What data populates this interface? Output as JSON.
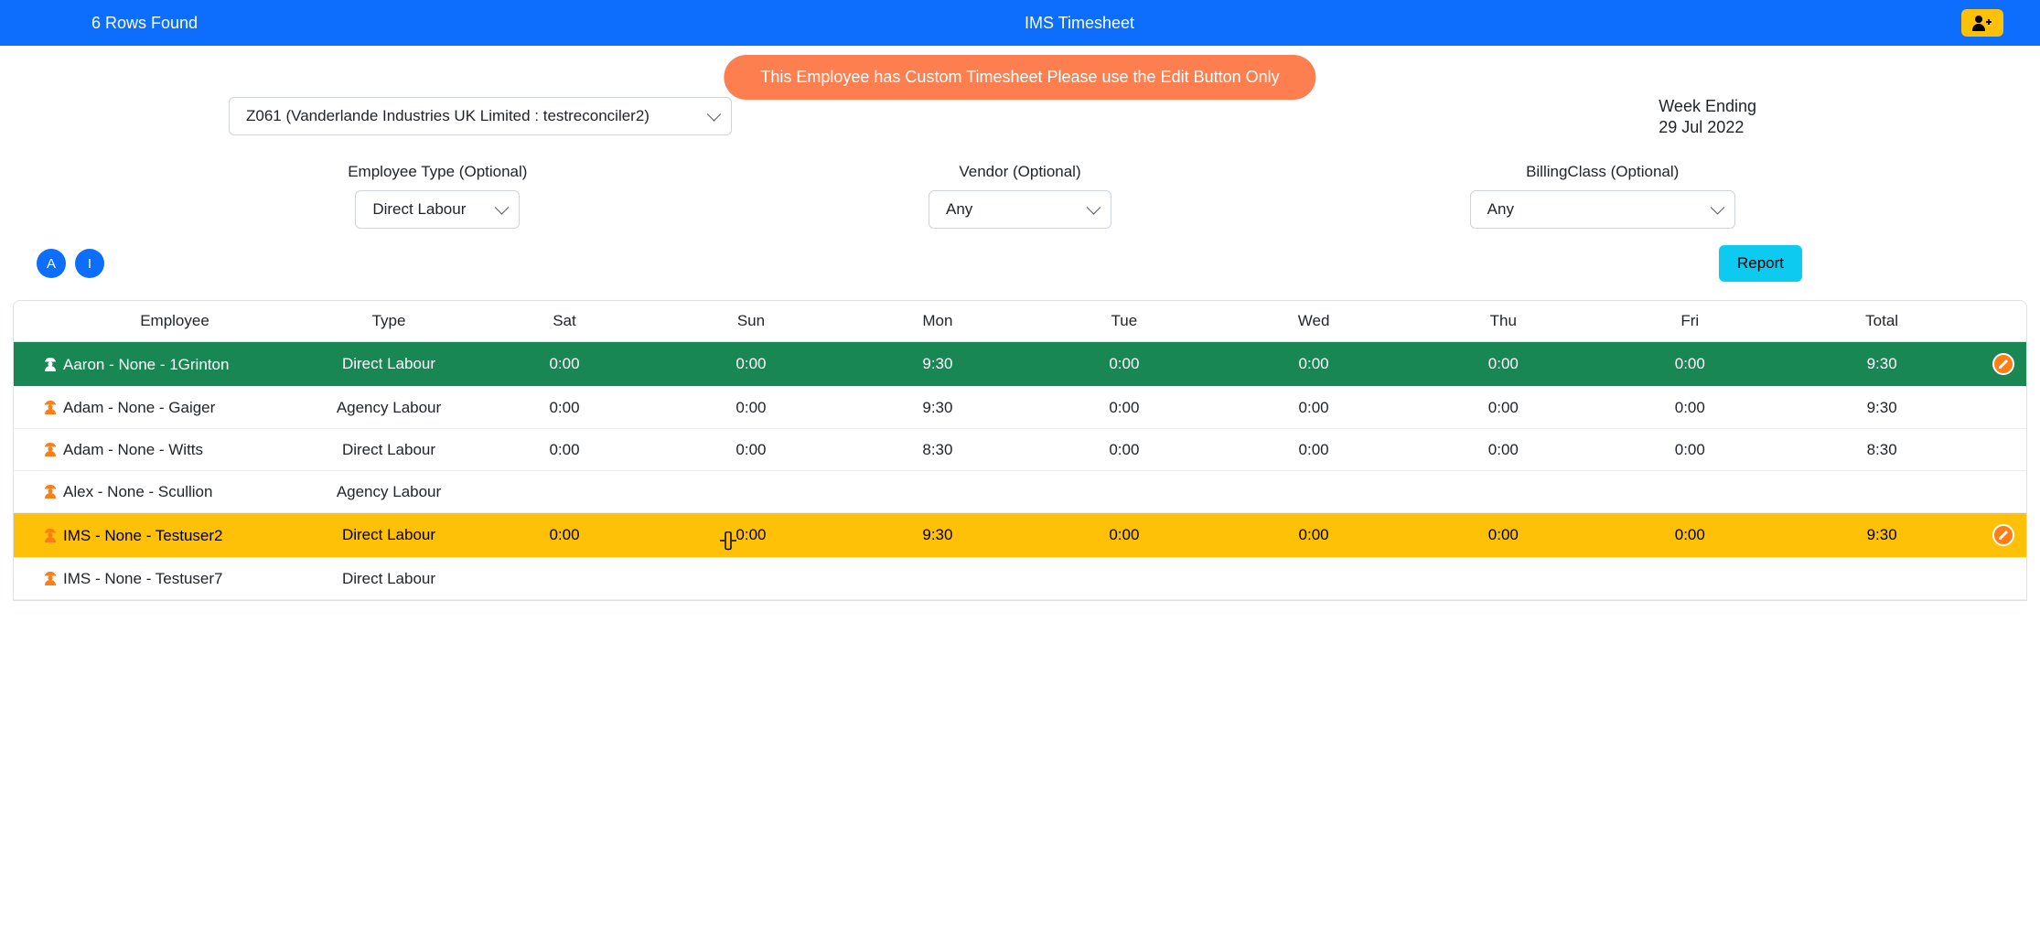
{
  "header": {
    "rows_found": "6 Rows Found",
    "title": "IMS Timesheet"
  },
  "alert": {
    "message": "This Employee has Custom Timesheet Please use the Edit Button Only"
  },
  "filters": {
    "project_selected": "Z061 (Vanderlande Industries UK Limited : testreconciler2)",
    "week_ending_label": "Week Ending",
    "week_ending_value": "29 Jul 2022",
    "employee_type": {
      "label": "Employee Type (Optional)",
      "value": "Direct Labour"
    },
    "vendor": {
      "label": "Vendor (Optional)",
      "value": "Any"
    },
    "billing_class": {
      "label": "BillingClass (Optional)",
      "value": "Any"
    }
  },
  "letter_filters": [
    "A",
    "I"
  ],
  "report_button": "Report",
  "table": {
    "headers": [
      "Employee",
      "Type",
      "Sat",
      "Sun",
      "Mon",
      "Tue",
      "Wed",
      "Thu",
      "Fri",
      "Total"
    ],
    "rows": [
      {
        "employee": "Aaron - None - 1Grinton",
        "type": "Direct Labour",
        "sat": "0:00",
        "sun": "0:00",
        "mon": "9:30",
        "tue": "0:00",
        "wed": "0:00",
        "thu": "0:00",
        "fri": "0:00",
        "total": "9:30",
        "status": "green",
        "icon_color": "white",
        "has_edit": true
      },
      {
        "employee": "Adam - None - Gaiger",
        "type": "Agency Labour",
        "sat": "0:00",
        "sun": "0:00",
        "mon": "9:30",
        "tue": "0:00",
        "wed": "0:00",
        "thu": "0:00",
        "fri": "0:00",
        "total": "9:30",
        "status": "default",
        "icon_color": "orange",
        "has_edit": false
      },
      {
        "employee": "Adam - None - Witts",
        "type": "Direct Labour",
        "sat": "0:00",
        "sun": "0:00",
        "mon": "8:30",
        "tue": "0:00",
        "wed": "0:00",
        "thu": "0:00",
        "fri": "0:00",
        "total": "8:30",
        "status": "default",
        "icon_color": "orange",
        "has_edit": false
      },
      {
        "employee": "Alex - None - Scullion",
        "type": "Agency Labour",
        "sat": "",
        "sun": "",
        "mon": "",
        "tue": "",
        "wed": "",
        "thu": "",
        "fri": "",
        "total": "",
        "status": "default",
        "icon_color": "orange",
        "has_edit": false
      },
      {
        "employee": "IMS - None - Testuser2",
        "type": "Direct Labour",
        "sat": "0:00",
        "sun": "0:00",
        "mon": "9:30",
        "tue": "0:00",
        "wed": "0:00",
        "thu": "0:00",
        "fri": "0:00",
        "total": "9:30",
        "status": "yellow",
        "icon_color": "orange",
        "has_edit": true,
        "cursor_at": "sun"
      },
      {
        "employee": "IMS - None - Testuser7",
        "type": "Direct Labour",
        "sat": "",
        "sun": "",
        "mon": "",
        "tue": "",
        "wed": "",
        "thu": "",
        "fri": "",
        "total": "",
        "status": "default",
        "icon_color": "orange",
        "has_edit": false
      }
    ]
  }
}
